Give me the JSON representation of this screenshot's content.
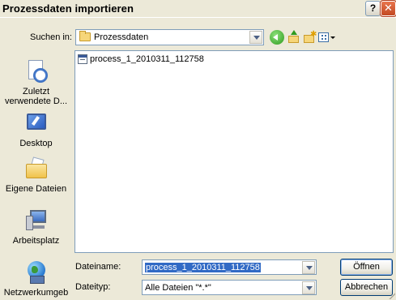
{
  "window": {
    "title": "Prozessdaten importieren",
    "help_glyph": "?",
    "close_glyph": "✕"
  },
  "toolbar": {
    "look_in_label": "Suchen in:",
    "look_in_value": "Prozessdaten",
    "icons": [
      "back-icon",
      "up-folder-icon",
      "new-folder-icon",
      "view-menu-icon"
    ]
  },
  "places": [
    {
      "label": "Zuletzt verwendete D...",
      "icon": "recent-documents-icon"
    },
    {
      "label": "Desktop",
      "icon": "desktop-icon"
    },
    {
      "label": "Eigene Dateien",
      "icon": "my-documents-icon"
    },
    {
      "label": "Arbeitsplatz",
      "icon": "my-computer-icon"
    },
    {
      "label": "Netzwerkumgeb",
      "icon": "network-icon"
    }
  ],
  "files": [
    {
      "name": "process_1_2010311_112758",
      "icon": "data-file-icon"
    }
  ],
  "form": {
    "filename_label": "Dateiname:",
    "filename_value": "process_1_2010311_112758",
    "filetype_label": "Dateityp:",
    "filetype_value": "Alle Dateien \"*.*\""
  },
  "buttons": {
    "open": "Öffnen",
    "cancel": "Abbrechen"
  }
}
